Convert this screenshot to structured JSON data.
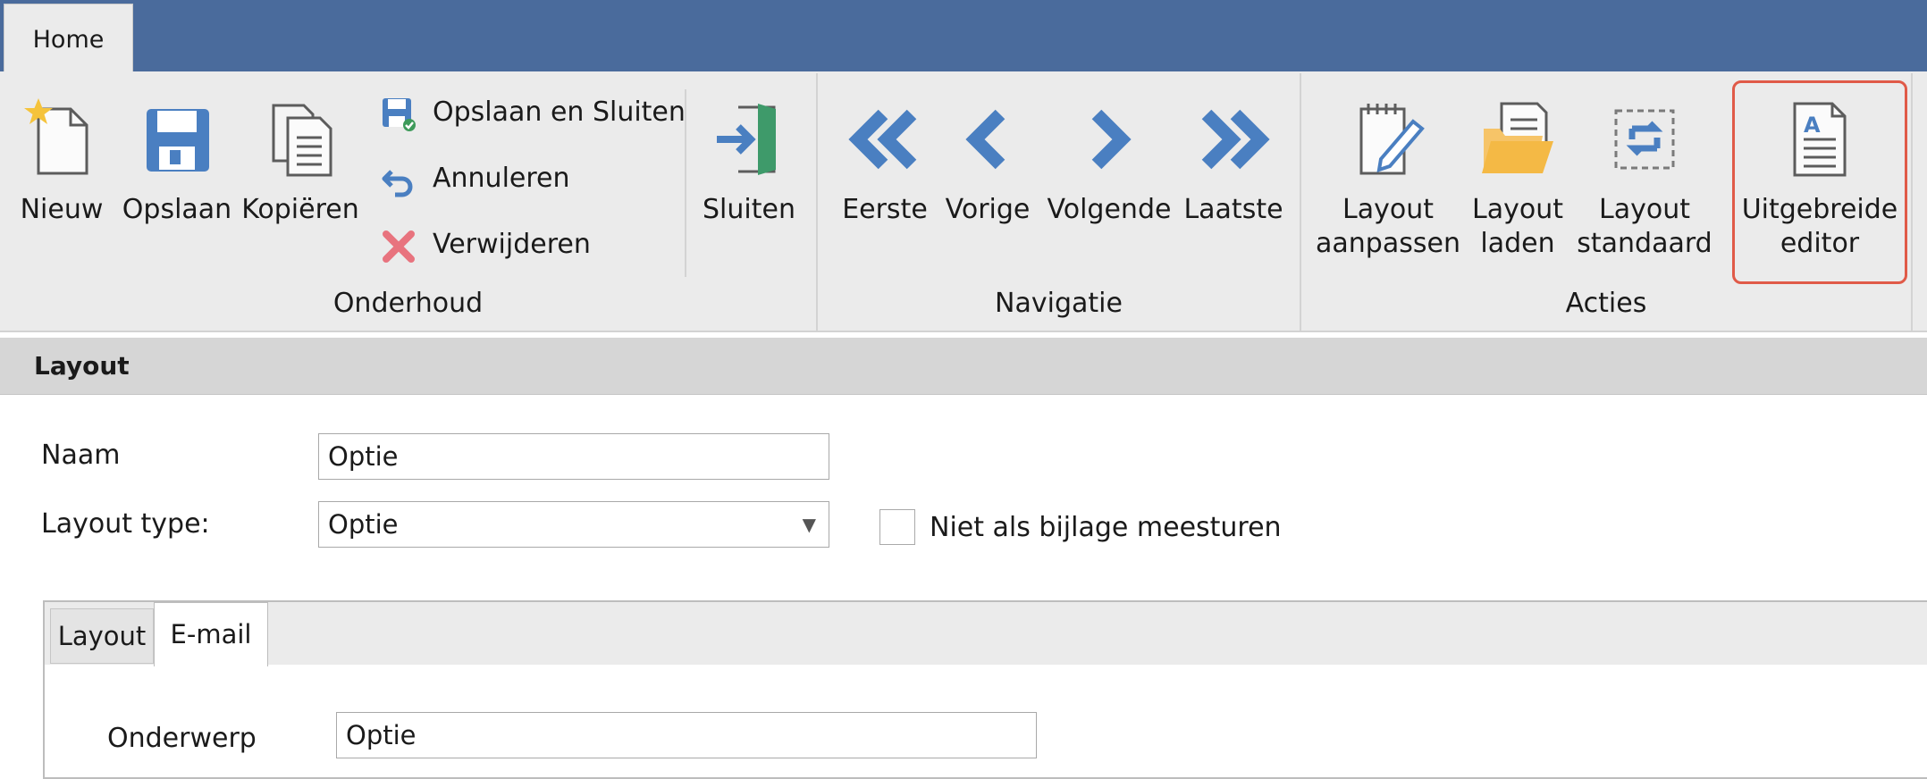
{
  "ribbon": {
    "tab_home": "Home",
    "buttons": {
      "nieuw": "Nieuw",
      "opslaan": "Opslaan",
      "kopieren": "Kopiëren",
      "opslaan_en_sluiten": "Opslaan en Sluiten",
      "annuleren": "Annuleren",
      "verwijderen": "Verwijderen",
      "sluiten": "Sluiten",
      "eerste": "Eerste",
      "vorige": "Vorige",
      "volgende": "Volgende",
      "laatste": "Laatste",
      "layout_aanpassen": "Layout\naanpassen",
      "layout_laden": "Layout\nladen",
      "layout_standaard": "Layout\nstandaard",
      "uitgebreide_editor": "Uitgebreide\neditor"
    },
    "groups": {
      "onderhoud": "Onderhoud",
      "navigatie": "Navigatie",
      "acties": "Acties"
    },
    "icons": {
      "nieuw": "new-document-star-icon",
      "opslaan": "floppy-disk-icon",
      "kopieren": "copy-documents-icon",
      "opslaan_en_sluiten": "save-and-close-icon",
      "annuleren": "undo-arrow-icon",
      "verwijderen": "delete-x-icon",
      "sluiten": "exit-door-icon",
      "eerste": "double-chevron-left-icon",
      "vorige": "chevron-left-icon",
      "volgende": "chevron-right-icon",
      "laatste": "double-chevron-right-icon",
      "layout_aanpassen": "edit-pencil-document-icon",
      "layout_laden": "open-folder-icon",
      "layout_standaard": "reset-layout-icon",
      "uitgebreide_editor": "text-document-icon"
    },
    "colors": {
      "accent_blue": "#4a7fc1",
      "title_bar": "#4a6b9c",
      "delete_red": "#e8737e",
      "highlight_border": "#e05a48"
    }
  },
  "section": {
    "title": "Layout"
  },
  "form": {
    "naam_label": "Naam",
    "naam_value": "Optie",
    "layout_type_label": "Layout type:",
    "layout_type_value": "Optie",
    "checkbox_label": "Niet als bijlage meesturen",
    "checkbox_checked": false
  },
  "tabs": [
    {
      "label": "Layout",
      "active": false
    },
    {
      "label": "E-mail",
      "active": true
    }
  ],
  "email": {
    "onderwerp_label": "Onderwerp",
    "onderwerp_value": "Optie"
  }
}
